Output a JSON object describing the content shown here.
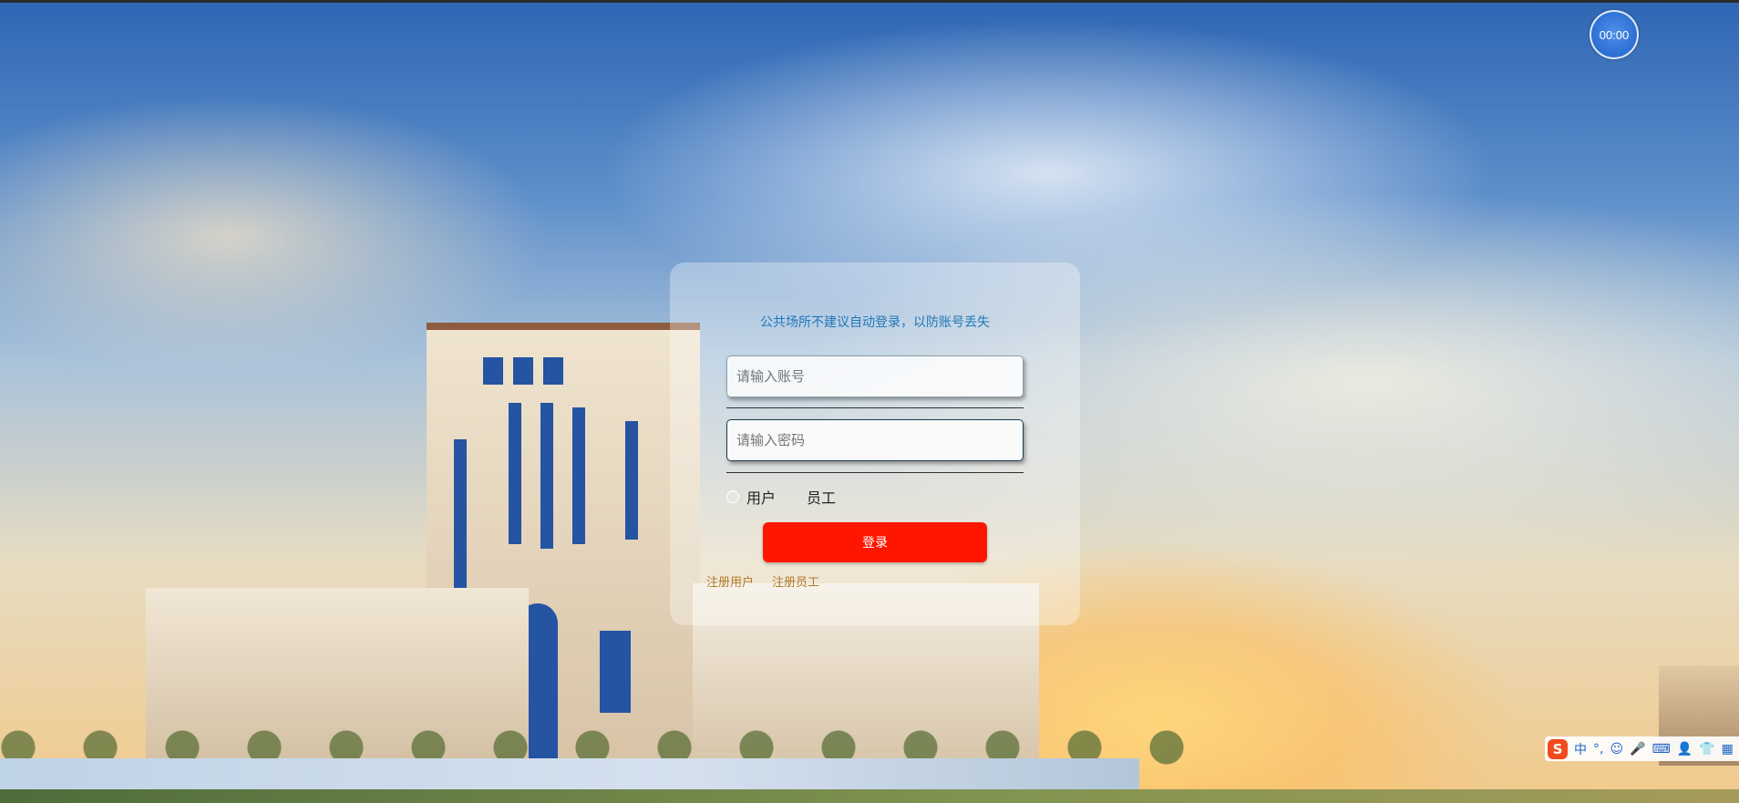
{
  "timer": {
    "text": "00:00"
  },
  "login": {
    "notice": "公共场所不建议自动登录，以防账号丢失",
    "account_placeholder": "请输入账号",
    "password_placeholder": "请输入密码",
    "roles": [
      {
        "label": "用户"
      },
      {
        "label": "员工"
      }
    ],
    "login_button": "登录",
    "links": {
      "register_user": "注册用户",
      "register_staff": "注册员工"
    }
  },
  "ime_toolbar": {
    "logo": "S",
    "mode": "中",
    "items": [
      "punctuation-icon",
      "emoji-icon",
      "microphone-icon",
      "keyboard-icon",
      "user-icon",
      "skin-icon",
      "grid-icon"
    ]
  },
  "colors": {
    "login_button": "#ff1600",
    "notice_text": "#1f77b8",
    "register_links": "#b07a2a",
    "timer": "#1f62c9"
  }
}
